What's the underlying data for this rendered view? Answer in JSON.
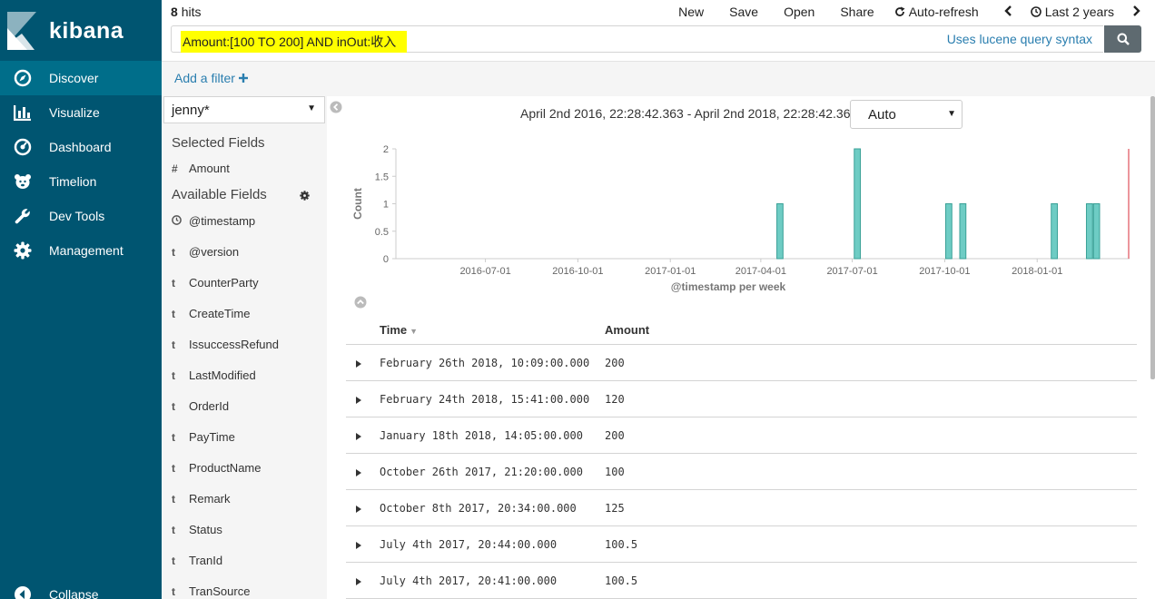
{
  "app": {
    "brand": "kibana"
  },
  "sidebar": {
    "items": [
      {
        "label": "Discover",
        "icon": "compass-icon",
        "active": true
      },
      {
        "label": "Visualize",
        "icon": "bar-chart-icon"
      },
      {
        "label": "Dashboard",
        "icon": "dashboard-gauge-icon"
      },
      {
        "label": "Timelion",
        "icon": "timelion-bear-icon"
      },
      {
        "label": "Dev Tools",
        "icon": "wrench-icon"
      },
      {
        "label": "Management",
        "icon": "gear-icon"
      }
    ],
    "collapse_label": "Collapse"
  },
  "topbar": {
    "hits_count": "8",
    "hits_label": "hits",
    "menu": {
      "new": "New",
      "save": "Save",
      "open": "Open",
      "share": "Share",
      "auto_refresh": "Auto-refresh",
      "time_range": "Last 2 years"
    }
  },
  "search": {
    "query": "Amount:[100 TO 200] AND inOut:收入",
    "syntax_hint": "Uses lucene query syntax"
  },
  "filter": {
    "add_label": "Add a filter"
  },
  "fields": {
    "index_pattern": "jenny*",
    "selected_title": "Selected Fields",
    "selected": [
      {
        "type": "#",
        "name": "Amount"
      }
    ],
    "available_title": "Available Fields",
    "available": [
      {
        "type": "clock",
        "name": "@timestamp"
      },
      {
        "type": "t",
        "name": "@version"
      },
      {
        "type": "t",
        "name": "CounterParty"
      },
      {
        "type": "t",
        "name": "CreateTime"
      },
      {
        "type": "t",
        "name": "IssuccessRefund"
      },
      {
        "type": "t",
        "name": "LastModified"
      },
      {
        "type": "t",
        "name": "OrderId"
      },
      {
        "type": "t",
        "name": "PayTime"
      },
      {
        "type": "t",
        "name": "ProductName"
      },
      {
        "type": "t",
        "name": "Remark"
      },
      {
        "type": "t",
        "name": "Status"
      },
      {
        "type": "t",
        "name": "TranId"
      },
      {
        "type": "t",
        "name": "TranSource"
      }
    ]
  },
  "histogram": {
    "time_range_text": "April 2nd 2016, 22:28:42.363 - April 2nd 2018, 22:28:42.363 —",
    "interval": "Auto"
  },
  "chart_data": {
    "type": "bar",
    "xlabel": "@timestamp per week",
    "ylabel": "Count",
    "ylim": [
      0,
      2
    ],
    "yticks": [
      "0",
      "0.5",
      "1",
      "1.5",
      "2"
    ],
    "x_ticks": [
      "2016-07-01",
      "2016-10-01",
      "2017-01-01",
      "2017-04-01",
      "2017-07-01",
      "2017-10-01",
      "2018-01-01"
    ],
    "x": [
      "2017-04-17",
      "2017-07-03",
      "2017-10-02",
      "2017-10-16",
      "2018-01-15",
      "2018-02-19",
      "2018-02-26"
    ],
    "values": [
      1,
      2,
      1,
      1,
      1,
      1,
      1
    ],
    "bar_color": "#6eccc4",
    "bar_stroke": "#3aa197",
    "now_marker_color": "#e6737a",
    "grid": false
  },
  "table": {
    "headers": {
      "time": "Time",
      "amount": "Amount"
    },
    "rows": [
      {
        "time": "February 26th 2018, 10:09:00.000",
        "amount": "200"
      },
      {
        "time": "February 24th 2018, 15:41:00.000",
        "amount": "120"
      },
      {
        "time": "January 18th 2018, 14:05:00.000",
        "amount": "200"
      },
      {
        "time": "October 26th 2017, 21:20:00.000",
        "amount": "100"
      },
      {
        "time": "October 8th 2017, 20:34:00.000",
        "amount": "125"
      },
      {
        "time": "July 4th 2017, 20:44:00.000",
        "amount": "100.5"
      },
      {
        "time": "July 4th 2017, 20:41:00.000",
        "amount": "100.5"
      }
    ]
  }
}
